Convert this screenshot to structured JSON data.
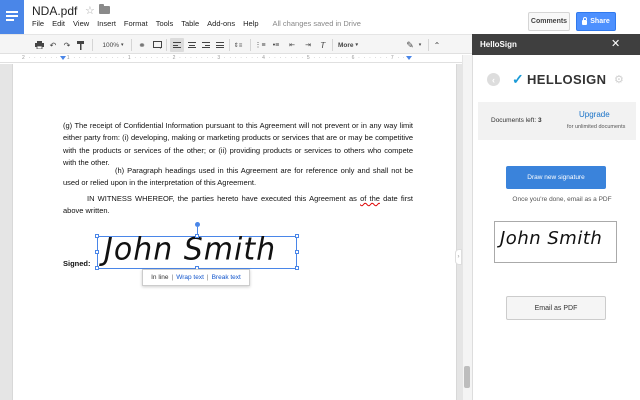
{
  "header": {
    "doc_title": "NDA.pdf",
    "menu": [
      "File",
      "Edit",
      "View",
      "Insert",
      "Format",
      "Tools",
      "Table",
      "Add-ons",
      "Help"
    ],
    "save_status": "All changes saved in Drive",
    "comments_label": "Comments",
    "share_label": "Share"
  },
  "toolbar": {
    "zoom": "100%",
    "more_label": "More"
  },
  "ruler": {
    "text": "2 · · · · · · · 1 · · · · · · · · · · 1 · · · · · · · 2 · · · · · · · 3 · · · · · · · 4 · · · · · · · 5 · · · · · · · 6 · · · · · · 7 · · ·"
  },
  "document": {
    "para_g": "(g) The receipt of Confidential Information pursuant to this Agreement will not prevent or in any way limit either party from: (i) developing, making or marketing products or services that are or may be competitive with the products or services of the other; or (ii) providing products or services to others who compete with the other.",
    "para_h": "(h) Paragraph headings used in this Agreement are for reference only and shall not be used or relied upon in the interpretation of this Agreement.",
    "para_witness_a": "IN WITNESS WHEREOF, the parties hereto have executed this Agreement as ",
    "para_witness_spell": "of the",
    "para_witness_b": " date first above written.",
    "signed_label": "Signed:",
    "signature": "John Smith",
    "wrap_options": {
      "inline": "In line",
      "wrap": "Wrap text",
      "break": "Break text"
    }
  },
  "sidebar": {
    "title": "HelloSign",
    "brand": "HELLOSIGN",
    "documents_left_label": "Documents left:",
    "documents_left_count": "3",
    "upgrade_label": "Upgrade",
    "upgrade_sub": "for unlimited documents",
    "draw_button_label": "Draw new signature",
    "email_hint": "Once you're done, email as a PDF",
    "signature_preview": "John Smith",
    "email_button_label": "Email as PDF"
  },
  "colors": {
    "docs_blue": "#4a86e8",
    "share_blue": "#4d90fe",
    "hellosign_blue": "#3a83db",
    "sidebar_header": "#3f3f3f"
  }
}
